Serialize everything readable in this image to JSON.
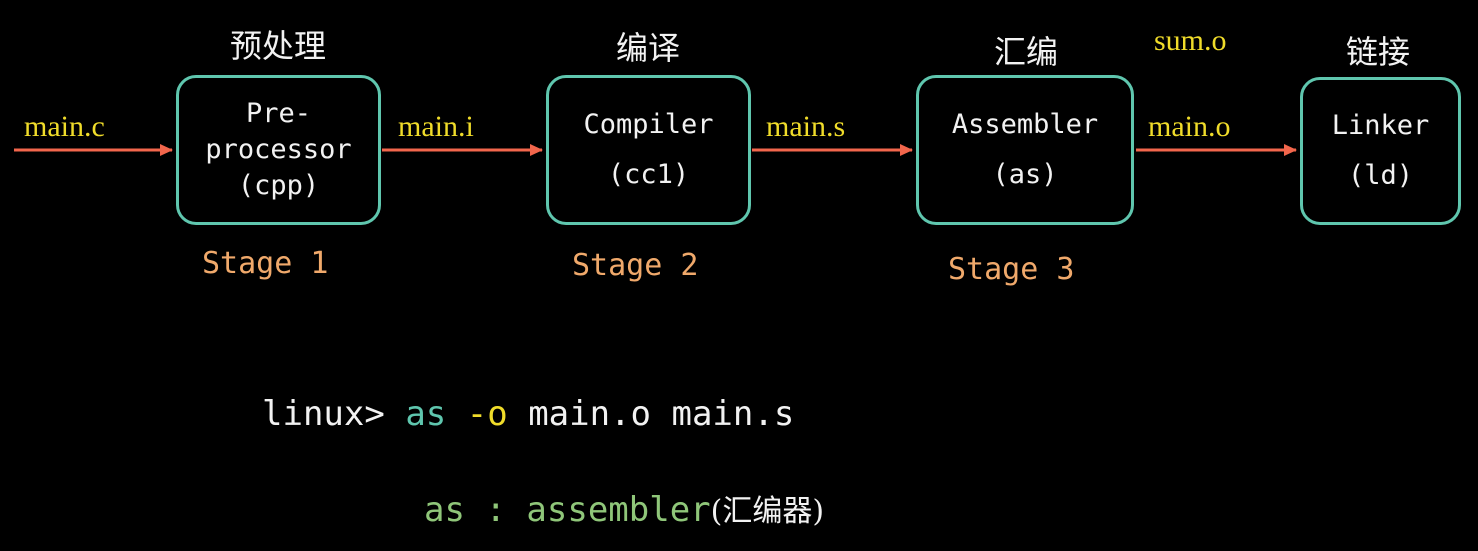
{
  "stages": [
    {
      "zh_label": "预处理",
      "box_lines": [
        "Pre-",
        "processor",
        "(cpp)"
      ],
      "stage_label": "Stage 1"
    },
    {
      "zh_label": "编译",
      "box_lines": [
        "Compiler",
        "(cc1)"
      ],
      "stage_label": "Stage 2"
    },
    {
      "zh_label": "汇编",
      "box_lines": [
        "Assembler",
        "(as)"
      ],
      "stage_label": "Stage 3"
    },
    {
      "zh_label": "链接",
      "box_lines": [
        "Linker",
        "(ld)"
      ],
      "stage_label": ""
    }
  ],
  "files": {
    "input": "main.c",
    "after_cpp": "main.i",
    "after_cc1": "main.s",
    "after_as": "main.o",
    "extra_object": "sum.o"
  },
  "command": {
    "prompt": "linux>",
    "program": "as",
    "flag": "-o",
    "args": "main.o main.s"
  },
  "note": {
    "term": "as",
    "separator": ":",
    "definition": "assembler",
    "zh": "(汇编器)"
  },
  "colors": {
    "background": "#000000",
    "box_border": "#5fc6ae",
    "arrow": "#f2664c",
    "file_label": "#f0dc2a",
    "stage_label": "#f0a96b"
  }
}
